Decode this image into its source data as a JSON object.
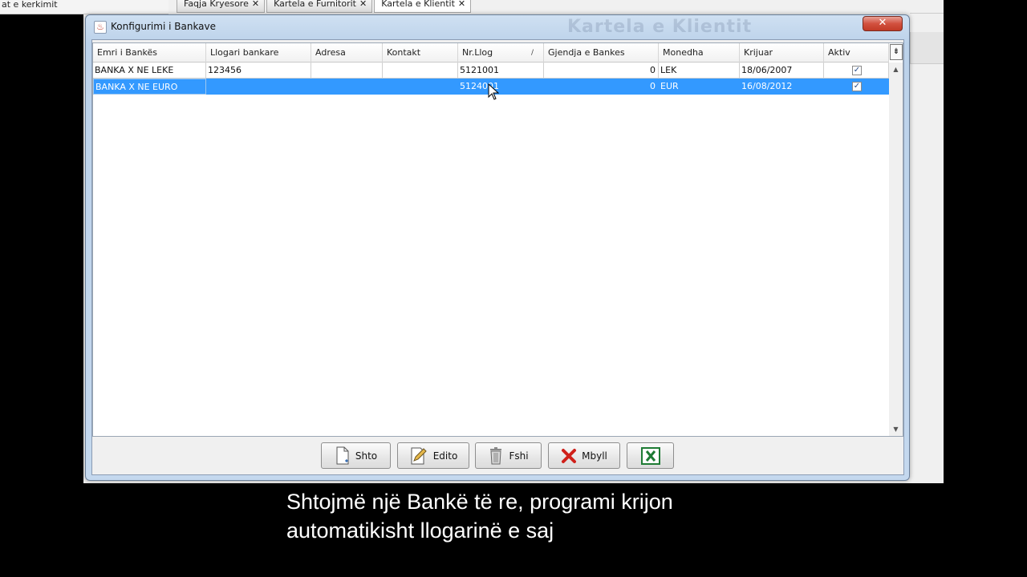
{
  "background": {
    "left_strip_text": "at e kerkimit",
    "tabs": [
      {
        "label": "Faqja Kryesore"
      },
      {
        "label": "Kartela e Furnitorit"
      },
      {
        "label": "Kartela e Klientit"
      }
    ],
    "ghost_title": "Kartela e Klientit"
  },
  "dialog": {
    "title": "Konfigurimi i Bankave",
    "close_glyph": "✕"
  },
  "table": {
    "columns": [
      "Emri i Bankës",
      "Llogari bankare",
      "Adresa",
      "Kontakt",
      "Nr.Llog",
      "Gjendja e Bankes",
      "Monedha",
      "Krijuar",
      "Aktiv"
    ],
    "sorted_column": "Nr.Llog",
    "sort_glyph": "/",
    "rows": [
      {
        "emri": "BANKA X NE LEKE",
        "llogari": "123456",
        "adresa": "",
        "kontakt": "",
        "nr_llog": "5121001",
        "gjendja": "0",
        "monedha": "LEK",
        "krijuar": "18/06/2007",
        "aktiv": true
      },
      {
        "emri": "BANKA X NE EURO",
        "llogari": "",
        "adresa": "",
        "kontakt": "",
        "nr_llog": "5124001",
        "gjendja": "0",
        "monedha": "EUR",
        "krijuar": "16/08/2012",
        "aktiv": true
      }
    ],
    "selected_row": 1,
    "check_glyph": "✓"
  },
  "buttons": {
    "shto": "Shto",
    "edito": "Edito",
    "fshi": "Fshi",
    "mbyll": "Mbyll"
  },
  "subtitle": {
    "line1": "Shtojmë një Bankë të re, programi krijon",
    "line2": "automatikisht llogarinë e saj"
  },
  "colors": {
    "selection": "#3399ff",
    "close_button": "#d2513f",
    "excel_green": "#1e7b34"
  }
}
